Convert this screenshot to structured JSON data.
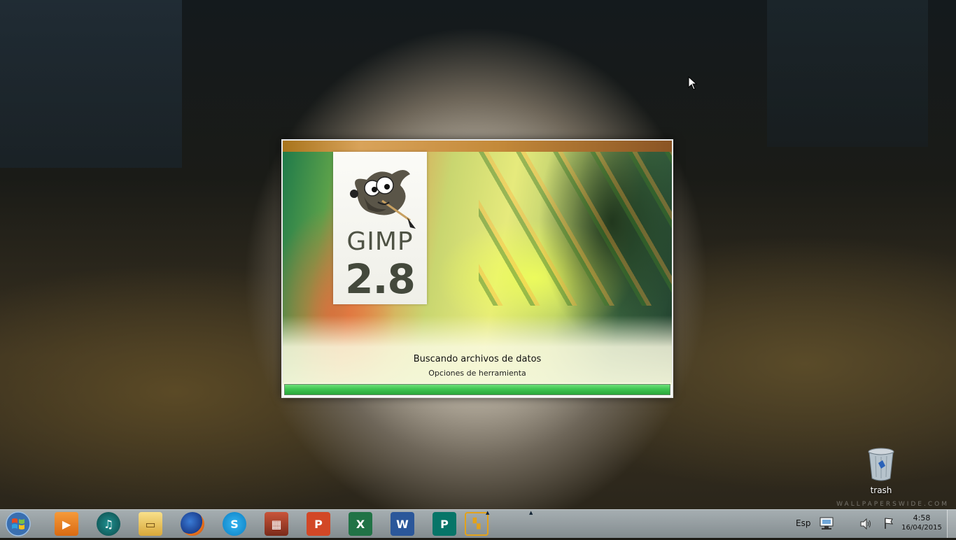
{
  "splash": {
    "app_name": "GIMP",
    "version": "2.8",
    "status": "Buscando archivos de datos",
    "substatus": "Opciones de herramienta",
    "progress": 1.0,
    "progress_color": "#3fc551"
  },
  "desktop": {
    "icons": [
      {
        "label": "trash",
        "icon": "recycle-bin-icon"
      }
    ],
    "watermark": "WALLPAPERSWIDE.COM"
  },
  "taskbar": {
    "start_icon": "windows-start-icon",
    "pinned": [
      {
        "name": "media-player-icon",
        "glyph": "▶"
      },
      {
        "name": "headphones-app-icon",
        "glyph": "🎧"
      },
      {
        "name": "file-explorer-icon",
        "glyph": "📁"
      },
      {
        "name": "firefox-icon",
        "glyph": ""
      },
      {
        "name": "skype-icon",
        "glyph": "S"
      },
      {
        "name": "media-center-icon",
        "glyph": ""
      },
      {
        "name": "powerpoint-icon",
        "glyph": "P"
      },
      {
        "name": "excel-icon",
        "glyph": "X"
      },
      {
        "name": "word-icon",
        "glyph": "W"
      },
      {
        "name": "publisher-icon",
        "glyph": "P"
      },
      {
        "name": "gimp-running-icon",
        "glyph": ""
      }
    ],
    "language": "Esp",
    "time": "4:58",
    "date": "16/04/2015"
  }
}
